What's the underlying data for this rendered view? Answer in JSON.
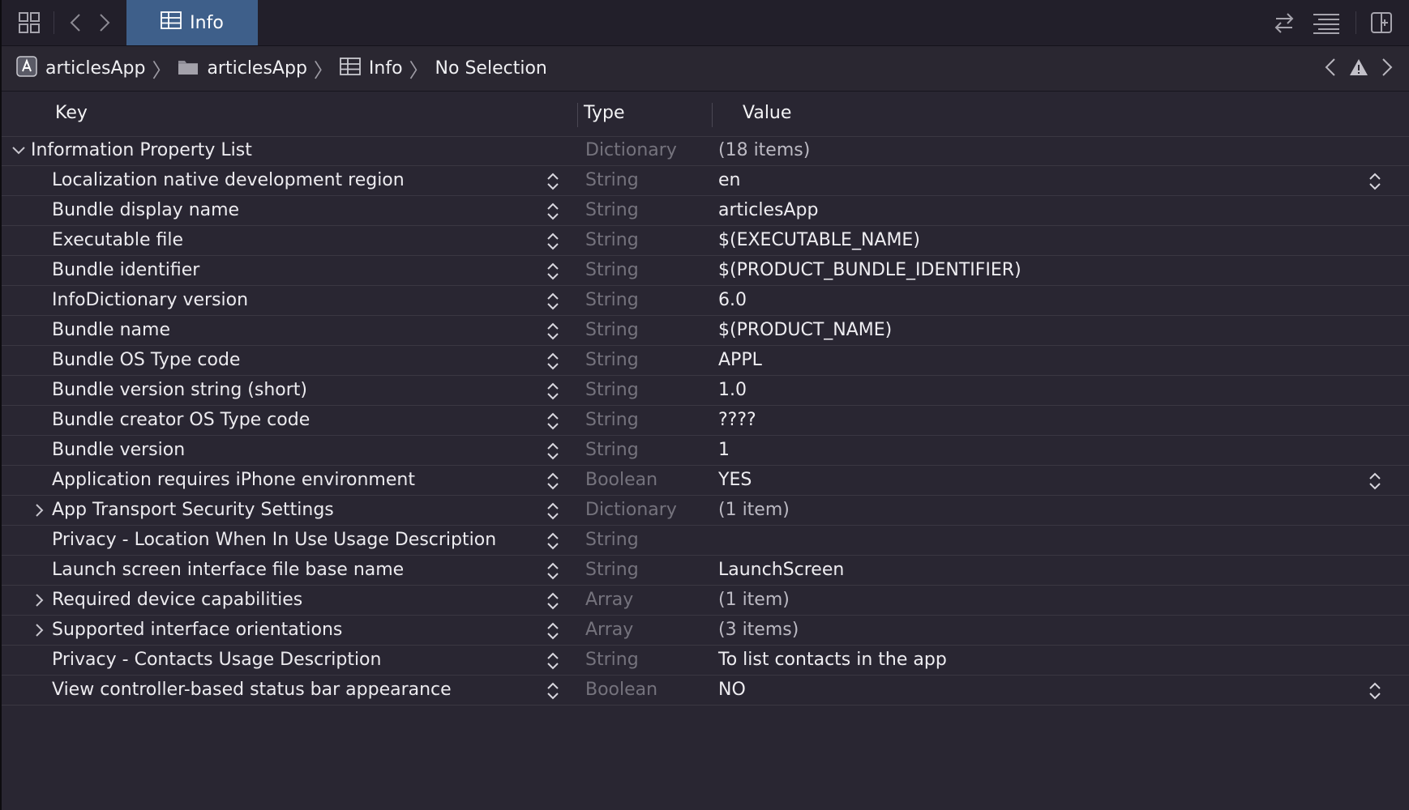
{
  "tab": {
    "label": "Info"
  },
  "jumpbar": {
    "crumbs": [
      "articlesApp",
      "articlesApp",
      "Info",
      "No Selection"
    ]
  },
  "columns": {
    "key": "Key",
    "type": "Type",
    "value": "Value"
  },
  "root": {
    "key": "Information Property List",
    "type": "Dictionary",
    "value": "(18 items)"
  },
  "rows": [
    {
      "key": "Localization native development region",
      "type": "String",
      "value": "en"
    },
    {
      "key": "Bundle display name",
      "type": "String",
      "value": "articlesApp"
    },
    {
      "key": "Executable file",
      "type": "String",
      "value": "$(EXECUTABLE_NAME)"
    },
    {
      "key": "Bundle identifier",
      "type": "String",
      "value": "$(PRODUCT_BUNDLE_IDENTIFIER)"
    },
    {
      "key": "InfoDictionary version",
      "type": "String",
      "value": "6.0"
    },
    {
      "key": "Bundle name",
      "type": "String",
      "value": "$(PRODUCT_NAME)"
    },
    {
      "key": "Bundle OS Type code",
      "type": "String",
      "value": "APPL"
    },
    {
      "key": "Bundle version string (short)",
      "type": "String",
      "value": "1.0"
    },
    {
      "key": "Bundle creator OS Type code",
      "type": "String",
      "value": "????"
    },
    {
      "key": "Bundle version",
      "type": "String",
      "value": "1"
    },
    {
      "key": "Application requires iPhone environment",
      "type": "Boolean",
      "value": "YES"
    },
    {
      "key": "App Transport Security Settings",
      "type": "Dictionary",
      "value": "(1 item)"
    },
    {
      "key": "Privacy - Location When In Use Usage Description",
      "type": "String",
      "value": ""
    },
    {
      "key": "Launch screen interface file base name",
      "type": "String",
      "value": "LaunchScreen"
    },
    {
      "key": "Required device capabilities",
      "type": "Array",
      "value": "(1 item)"
    },
    {
      "key": "Supported interface orientations",
      "type": "Array",
      "value": "(3 items)"
    },
    {
      "key": "Privacy - Contacts Usage Description",
      "type": "String",
      "value": "To list contacts in the app"
    },
    {
      "key": "View controller-based status bar appearance",
      "type": "Boolean",
      "value": "NO"
    }
  ]
}
